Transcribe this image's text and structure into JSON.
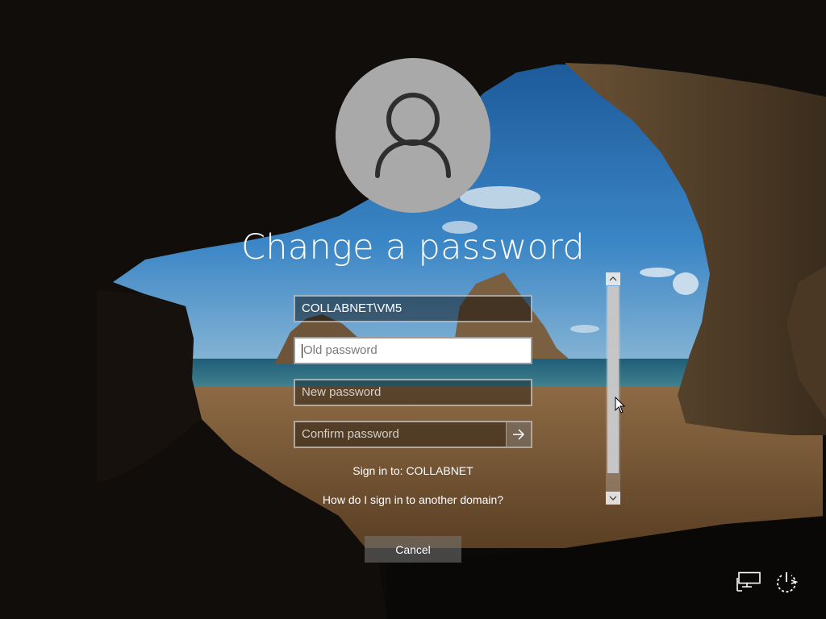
{
  "screen": {
    "title": "Change a password"
  },
  "fields": {
    "username_value": "COLLABNET\\VM5",
    "old_password_placeholder": "Old password",
    "new_password_placeholder": "New password",
    "confirm_password_placeholder": "Confirm password"
  },
  "signin_to": "Sign in to: COLLABNET",
  "other_domain_link": "How do I sign in to another domain?",
  "cancel_label": "Cancel",
  "icons": {
    "avatar": "user-silhouette-icon",
    "submit": "arrow-right-icon",
    "network": "network-icon",
    "power": "power-icon"
  },
  "colors": {
    "text": "#ffffff",
    "field_border": "#cfcfcf",
    "avatar_bg": "#a9a9a9"
  }
}
